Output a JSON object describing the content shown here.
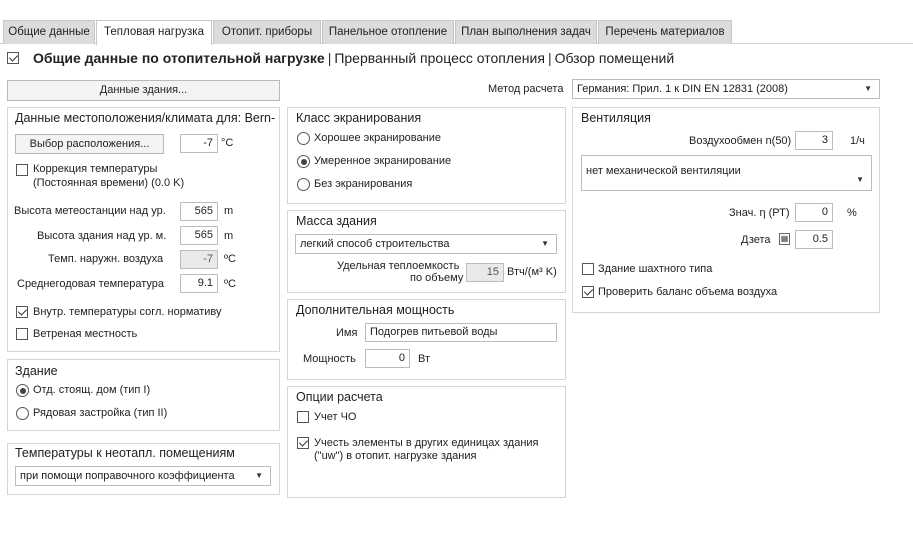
{
  "tabs": [
    "Общие данные",
    "Тепловая нагрузка",
    "Отопит. приборы",
    "Панельное отопление",
    "План выполнения задач",
    "Перечень материалов"
  ],
  "subheader": {
    "title": "Общие данные по отопительной нагрузке",
    "link1": "Прерванный процесс отопления",
    "link2": "Обзор помещений"
  },
  "building_data_button": "Данные здания...",
  "calc_method": {
    "label": "Метод расчета",
    "value": "Германия: Прил. 1 к DIN EN 12831 (2008)"
  },
  "location": {
    "title": "Данные местоположения/климата для: Bern-",
    "select_button": "Выбор расположения...",
    "temp_value": "-7",
    "temp_unit": "°C",
    "correction_label_1": "Коррекция температуры",
    "correction_label_2": "(Постоянная времени) (0.0 K)",
    "station_height_label": "Высота метеостанции над ур.",
    "station_height_value": "565",
    "station_height_unit": "m",
    "building_height_label": "Высота здания над ур. м.",
    "building_height_value": "565",
    "building_height_unit": "m",
    "outdoor_temp_label": "Темп. наружн. воздуха",
    "outdoor_temp_value": "-7",
    "outdoor_temp_unit": "ºC",
    "avg_temp_label": "Среднегодовая температура",
    "avg_temp_value": "9.1",
    "avg_temp_unit": "ºC",
    "inner_temp_label": "Внутр. температуры согл. нормативу",
    "windy_label": "Ветреная местность"
  },
  "building": {
    "title": "Здание",
    "option1": "Отд. стоящ. дом (тип I)",
    "option2": "Рядовая застройка (тип II)"
  },
  "unheated": {
    "title": "Температуры к неотапл. помещениям",
    "value": "при помощи поправочного коэффициента"
  },
  "shielding": {
    "title": "Класс экранирования",
    "option1": "Хорошее экранирование",
    "option2": "Умеренное экранирование",
    "option3": "Без экранирования"
  },
  "mass": {
    "title": "Масса здания",
    "value": "легкий способ строительства",
    "capacity_label_1": "Удельная теплоемкость",
    "capacity_label_2": "по объему",
    "capacity_value": "15",
    "capacity_unit": "Втч/(м³ K)"
  },
  "extra_power": {
    "title": "Дополнительная мощность",
    "name_label": "Имя",
    "name_value": "Подогрев питьевой воды",
    "power_label": "Мощность",
    "power_value": "0",
    "power_unit": "Вт"
  },
  "options": {
    "title": "Опции расчета",
    "opt1": "Учет ЧО",
    "opt2_line1": "Учесть элементы в других единицах здания",
    "opt2_line2": "(\"uw\") в отопит. нагрузке здания"
  },
  "ventilation": {
    "title": "Вентиляция",
    "air_exchange_label": "Воздухообмен n(50)",
    "air_exchange_value": "3",
    "air_exchange_unit": "1/ч",
    "system_value": "нет механической вентиляции",
    "eta_label": "Знач. η (РТ)",
    "eta_value": "0",
    "eta_unit": "%",
    "zeta_label": "Дзета",
    "zeta_value": "0.5",
    "shaft_label": "Здание шахтного типа",
    "balance_label": "Проверить баланс объема воздуха"
  },
  "colors": {
    "tab_bg": "#dcdcdc",
    "border": "#d5d5d5",
    "text": "#222222"
  }
}
